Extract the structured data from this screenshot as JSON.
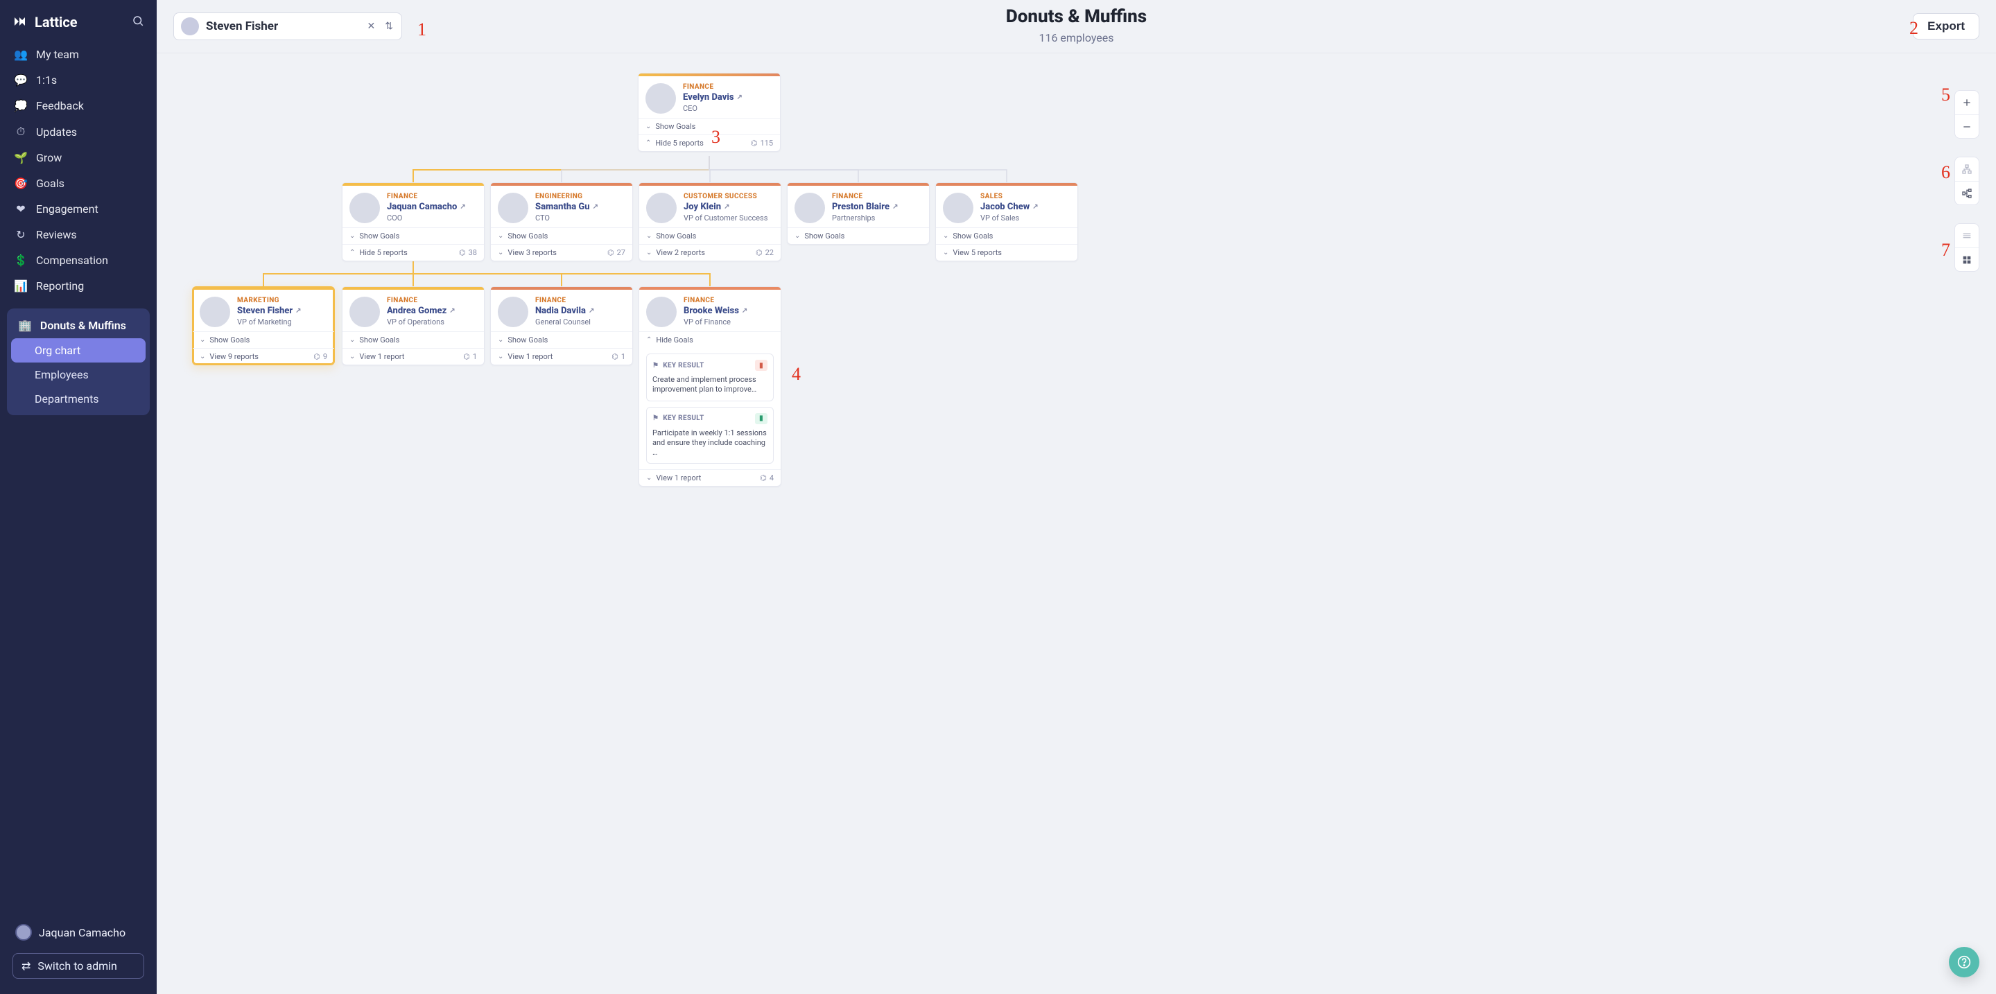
{
  "brand": {
    "name": "Lattice"
  },
  "sidebar": {
    "search_label": "Search",
    "items": [
      {
        "icon": "👥",
        "label": "My team"
      },
      {
        "icon": "💬",
        "label": "1:1s"
      },
      {
        "icon": "💭",
        "label": "Feedback"
      },
      {
        "icon": "⏱",
        "label": "Updates"
      },
      {
        "icon": "🌱",
        "label": "Grow"
      },
      {
        "icon": "🎯",
        "label": "Goals"
      },
      {
        "icon": "❤",
        "label": "Engagement"
      },
      {
        "icon": "↻",
        "label": "Reviews"
      },
      {
        "icon": "💲",
        "label": "Compensation"
      },
      {
        "icon": "📊",
        "label": "Reporting"
      }
    ],
    "section": {
      "title": "Donuts & Muffins",
      "items": [
        {
          "label": "Org chart",
          "active": true
        },
        {
          "label": "Employees",
          "active": false
        },
        {
          "label": "Departments",
          "active": false
        }
      ]
    },
    "user": {
      "name": "Jaquan Camacho"
    },
    "switch_admin": "Switch to admin"
  },
  "topbar": {
    "picker": {
      "name": "Steven Fisher"
    },
    "title": "Donuts & Muffins",
    "subtitle": "116 employees",
    "export": "Export"
  },
  "annotations": {
    "a1": "1",
    "a2": "2",
    "a3": "3",
    "a4": "4",
    "a5": "5",
    "a6": "6",
    "a7": "7"
  },
  "colors": {
    "marketing": "#d67a2c",
    "finance": "#d67a2c",
    "engineering": "#d67a2c",
    "customer_success": "#d67a2c",
    "sales": "#d67a2c"
  },
  "chart": {
    "root": {
      "dept": "FINANCE",
      "name": "Evelyn Davis",
      "role": "CEO",
      "show_goals": "Show Goals",
      "reports_label": "Hide 5 reports",
      "count": "115"
    },
    "level2": [
      {
        "dept": "FINANCE",
        "name": "Jaquan Camacho",
        "role": "COO",
        "show_goals": "Show Goals",
        "reports_label": "Hide 5 reports",
        "count": "38",
        "stripe": "#f4bd4a"
      },
      {
        "dept": "ENGINEERING",
        "name": "Samantha Gu",
        "role": "CTO",
        "show_goals": "Show Goals",
        "reports_label": "View 3 reports",
        "count": "27",
        "stripe": "#e2865f"
      },
      {
        "dept": "CUSTOMER SUCCESS",
        "name": "Joy Klein",
        "role": "VP of Customer Success",
        "show_goals": "Show Goals",
        "reports_label": "View 2 reports",
        "count": "22",
        "stripe": "#e2865f"
      },
      {
        "dept": "FINANCE",
        "name": "Preston Blaire",
        "role": "Partnerships",
        "show_goals": "Show Goals",
        "reports_label": "",
        "count": "",
        "stripe": "#e2865f"
      },
      {
        "dept": "SALES",
        "name": "Jacob Chew",
        "role": "VP of Sales",
        "show_goals": "Show Goals",
        "reports_label": "View 5 reports",
        "count": "",
        "stripe": "#e2865f"
      }
    ],
    "level3": [
      {
        "dept": "MARKETING",
        "name": "Steven Fisher",
        "role": "VP of Marketing",
        "show_goals": "Show Goals",
        "reports_label": "View 9 reports",
        "count": "9",
        "stripe": "#f4bd4a",
        "highlight": true
      },
      {
        "dept": "FINANCE",
        "name": "Andrea Gomez",
        "role": "VP of Operations",
        "show_goals": "Show Goals",
        "reports_label": "View 1 report",
        "count": "1",
        "stripe": "#f4bd4a"
      },
      {
        "dept": "FINANCE",
        "name": "Nadia Davila",
        "role": "General Counsel",
        "show_goals": "Show Goals",
        "reports_label": "View 1 report",
        "count": "1",
        "stripe": "#e2865f"
      },
      {
        "dept": "FINANCE",
        "name": "Brooke Weiss",
        "role": "VP of Finance",
        "hide_goals": "Hide Goals",
        "reports_label": "View 1 report",
        "count": "4",
        "stripe": "#e88a63",
        "goals": [
          {
            "badge": "KEY RESULT",
            "status": "red",
            "text": "Create and implement process improvement plan to improve…"
          },
          {
            "badge": "KEY RESULT",
            "status": "green",
            "text": "Participate in weekly 1:1 sessions and ensure they include coaching …"
          }
        ]
      }
    ]
  }
}
